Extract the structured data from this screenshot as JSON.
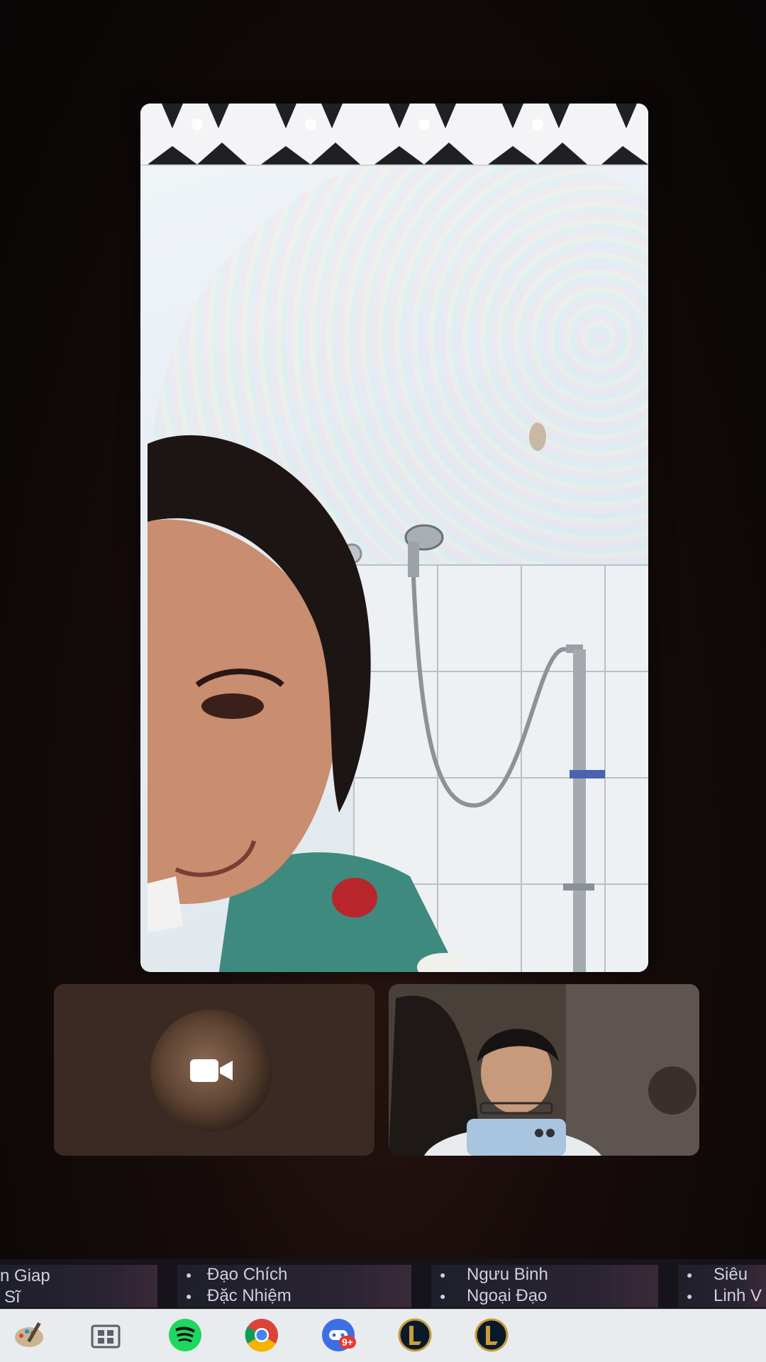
{
  "thumbnails": {
    "left": {
      "icon": "video-camera-icon"
    },
    "right": {
      "icon": "participant-video"
    }
  },
  "tiles": [
    {
      "line1": "n Giap",
      "line2": "Sĩ"
    },
    {
      "line1": "Đạo Chích",
      "line2": "Đặc Nhiệm"
    },
    {
      "line1": "Ngưu Binh",
      "line2": "Ngoại Đạo"
    },
    {
      "line1": "Siêu",
      "line2": "Linh V"
    }
  ],
  "taskbar": {
    "icons": [
      "paint-icon",
      "store-icon",
      "spotify-icon",
      "chrome-icon",
      "game-launcher-icon",
      "league-icon",
      "league-icon"
    ],
    "badge": "9+"
  },
  "colors": {
    "spotify": "#1ed760",
    "chrome_red": "#db4437",
    "chrome_yellow": "#f4b400",
    "chrome_green": "#0f9d58",
    "chrome_blue": "#4285f4"
  }
}
